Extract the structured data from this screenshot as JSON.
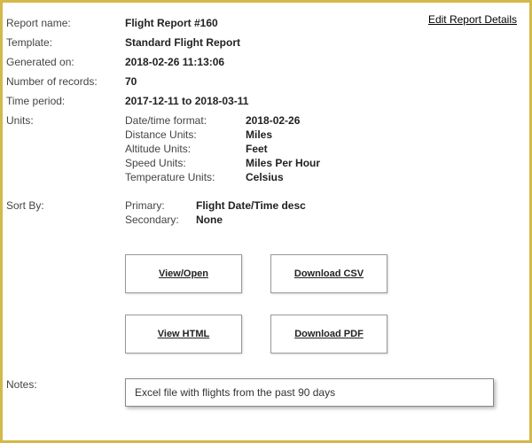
{
  "header": {
    "edit_link": "Edit Report Details"
  },
  "fields": {
    "report_name_label": "Report name:",
    "report_name_value": "Flight Report #160",
    "template_label": "Template:",
    "template_value": "Standard Flight Report",
    "generated_label": "Generated on:",
    "generated_value": "2018-02-26 11:13:06",
    "records_label": "Number of records:",
    "records_value": "70",
    "period_label": "Time period:",
    "period_value": "2017-12-11 to 2018-03-11",
    "units_label": "Units:",
    "sort_label": "Sort By:",
    "notes_label": "Notes:"
  },
  "units": {
    "datetime_label": "Date/time format:",
    "datetime_value": "2018-02-26",
    "distance_label": "Distance Units:",
    "distance_value": "Miles",
    "altitude_label": "Altitude Units:",
    "altitude_value": "Feet",
    "speed_label": "Speed Units:",
    "speed_value": "Miles Per Hour",
    "temp_label": "Temperature Units:",
    "temp_value": "Celsius"
  },
  "sort": {
    "primary_label": "Primary:",
    "primary_value": "Flight Date/Time desc",
    "secondary_label": "Secondary:",
    "secondary_value": "None"
  },
  "buttons": {
    "view_open": "View/Open",
    "download_csv": "Download CSV",
    "view_html": "View HTML",
    "download_pdf": "Download PDF"
  },
  "notes": {
    "text": "Excel file with flights from the past 90 days"
  }
}
